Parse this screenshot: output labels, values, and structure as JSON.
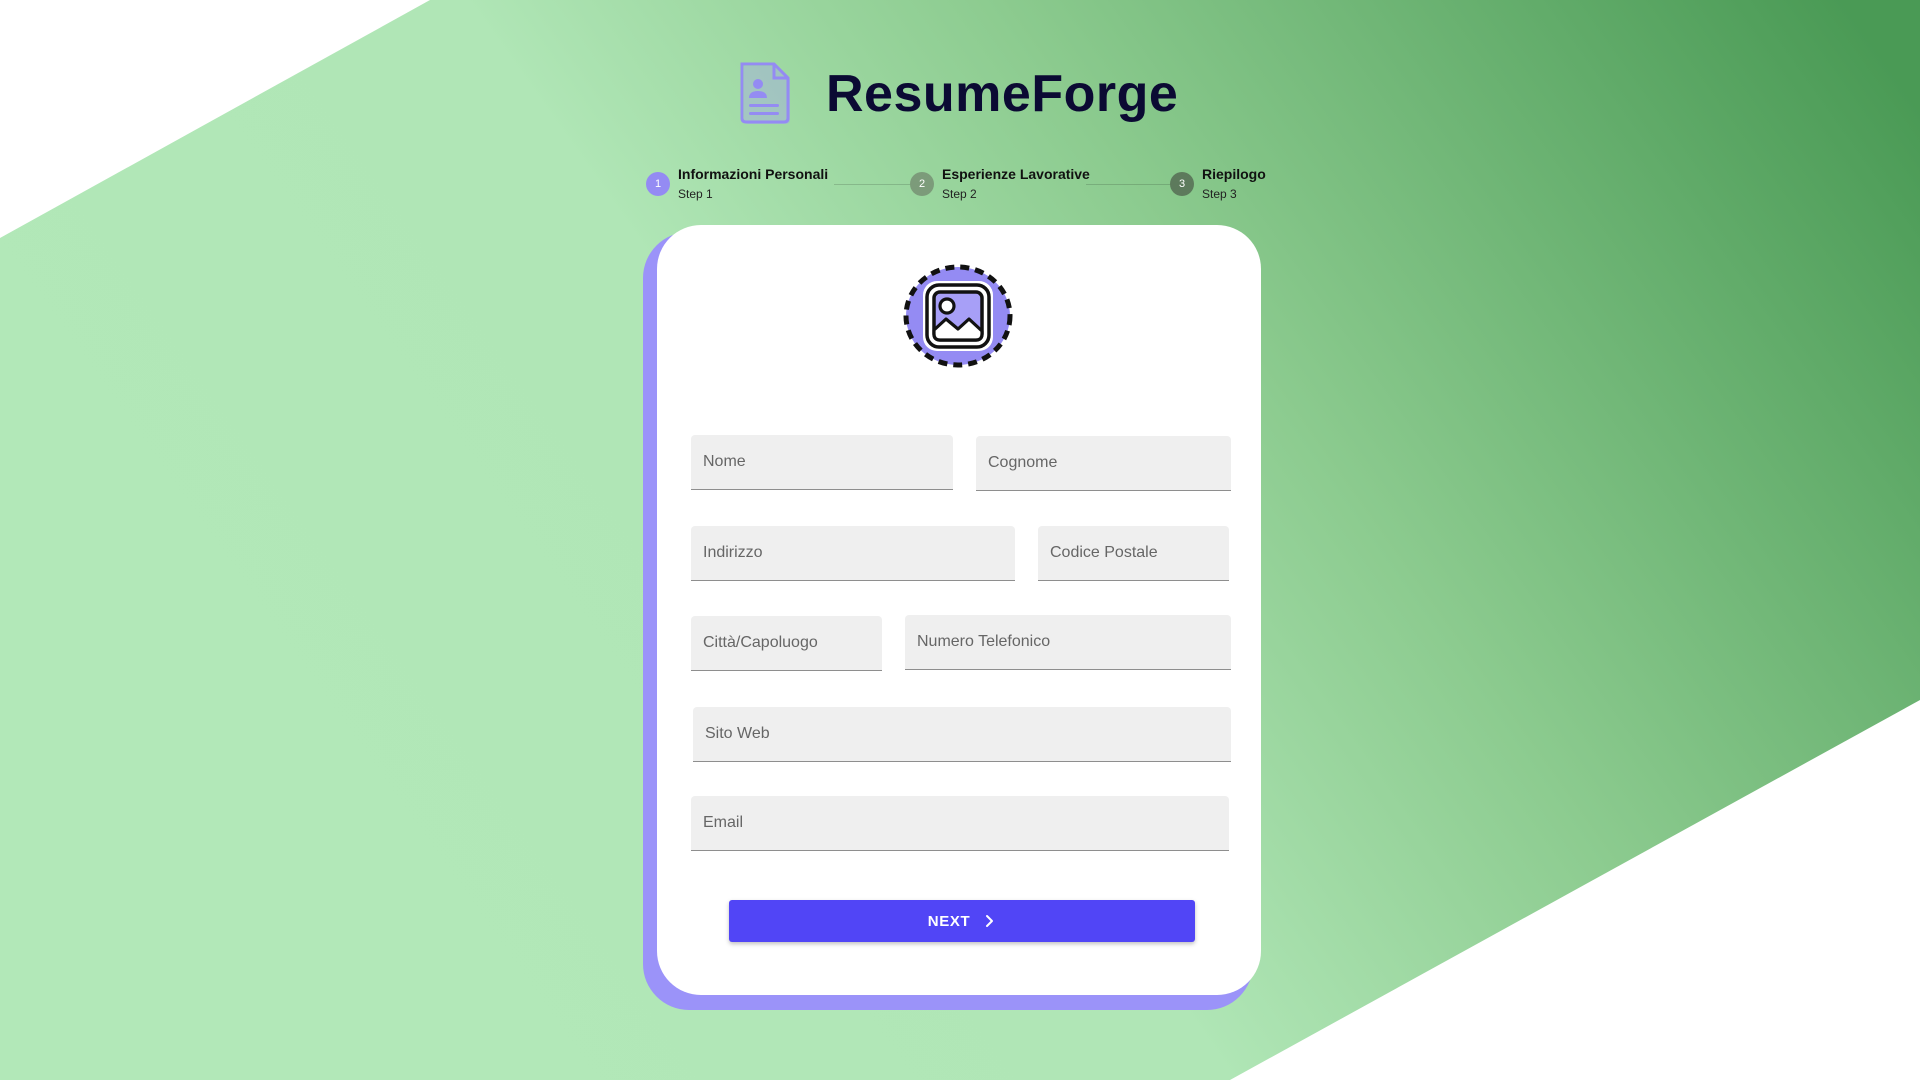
{
  "app": {
    "title": "ResumeForge",
    "logo_icon": "resume-document-icon"
  },
  "stepper": {
    "steps": [
      {
        "number": "1",
        "title": "Informazioni Personali",
        "subtitle": "Step 1",
        "color": "#948bf3"
      },
      {
        "number": "2",
        "title": "Esperienze Lavorative",
        "subtitle": "Step 2",
        "color": "#7c9b7a"
      },
      {
        "number": "3",
        "title": "Riepilogo",
        "subtitle": "Step 3",
        "color": "#5d7a5c"
      }
    ]
  },
  "form": {
    "avatar_icon": "image-upload-icon",
    "fields": {
      "nome": {
        "placeholder": "Nome",
        "value": ""
      },
      "cognome": {
        "placeholder": "Cognome",
        "value": ""
      },
      "indirizzo": {
        "placeholder": "Indirizzo",
        "value": ""
      },
      "codice_postale": {
        "placeholder": "Codice Postale",
        "value": ""
      },
      "citta": {
        "placeholder": "Città/Capoluogo",
        "value": ""
      },
      "telefono": {
        "placeholder": "Numero Telefonico",
        "value": ""
      },
      "sito_web": {
        "placeholder": "Sito Web",
        "value": ""
      },
      "email": {
        "placeholder": "Email",
        "value": ""
      }
    },
    "next_label": "NEXT"
  },
  "colors": {
    "accent": "#5145f6",
    "card_shadow": "#9b93f9",
    "background_green": "#b2e8b8",
    "dark_green": "#4a9a55"
  }
}
